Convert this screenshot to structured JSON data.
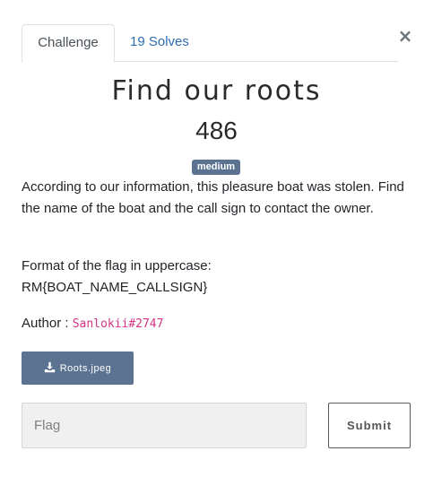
{
  "modal": {
    "close_label": "×"
  },
  "tabs": [
    {
      "label": "Challenge",
      "active": true
    },
    {
      "label": "19 Solves",
      "active": false
    }
  ],
  "challenge": {
    "name": "Find our roots",
    "points": "486",
    "difficulty": "medium",
    "description_1": "According to our information, this pleasure boat was stolen. Find the name of the boat and the call sign to contact the owner.",
    "description_2_line1": "Format of the flag in uppercase:",
    "description_2_line2": "RM{BOAT_NAME_CALLSIGN}",
    "author_label": "Author :",
    "author_name": "Sanlokii#2747",
    "file_name": "Roots.jpeg"
  },
  "form": {
    "flag_placeholder": "Flag",
    "flag_value": "",
    "submit_label": "Submit"
  },
  "colors": {
    "accent": "#5c7291",
    "link": "#2f6cb2",
    "author_code": "#d63384"
  }
}
